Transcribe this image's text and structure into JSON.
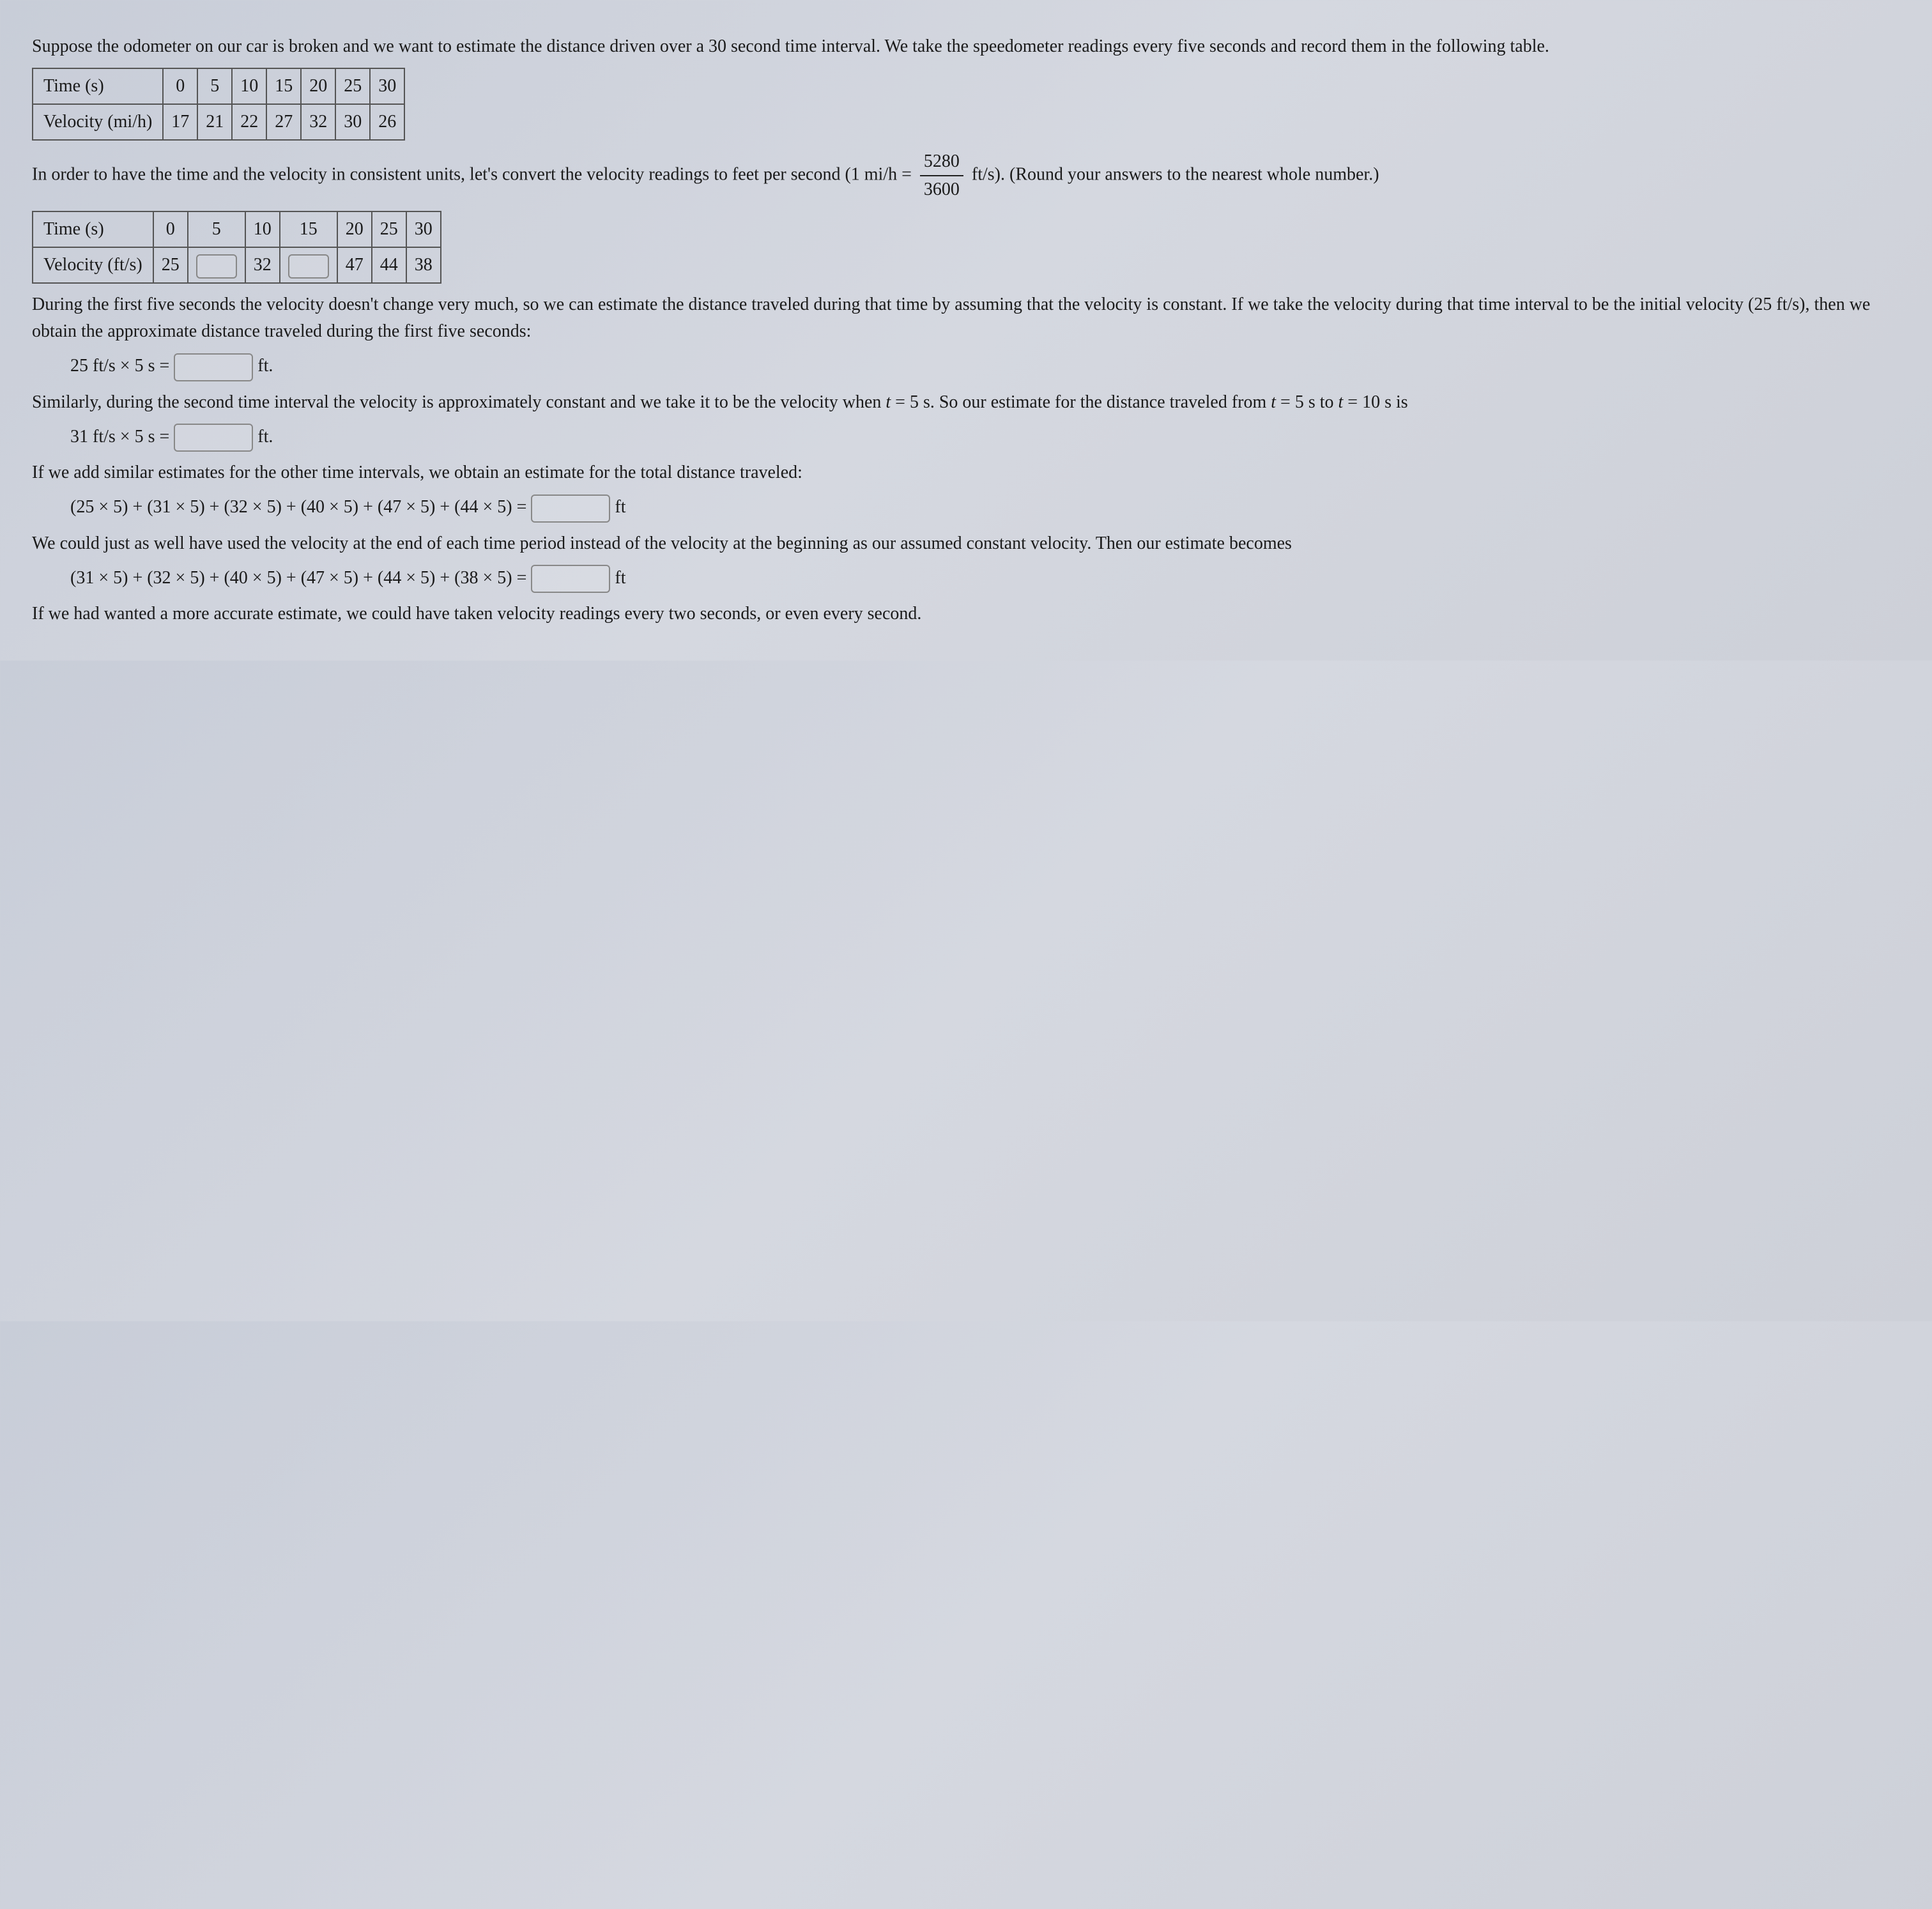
{
  "intro": "Suppose the odometer on our car is broken and we want to estimate the distance driven over a 30 second time interval. We take the speedometer readings every five seconds and record them in the following table.",
  "table1": {
    "row1label": "Time (s)",
    "row1": [
      "0",
      "5",
      "10",
      "15",
      "20",
      "25",
      "30"
    ],
    "row2label": "Velocity (mi/h)",
    "row2": [
      "17",
      "21",
      "22",
      "27",
      "32",
      "30",
      "26"
    ]
  },
  "convert_pre": "In order to have the time and the velocity in consistent units, let's convert the velocity readings to feet per second (1 mi/h =",
  "frac_num": "5280",
  "frac_den": "3600",
  "convert_post": "ft/s). (Round your answers to the nearest whole number.)",
  "table2": {
    "row1label": "Time (s)",
    "row1": [
      "0",
      "5",
      "10",
      "15",
      "20",
      "25",
      "30"
    ],
    "row2label": "Velocity (ft/s)",
    "row2_0": "25",
    "row2_2": "32",
    "row2_4": "47",
    "row2_5": "44",
    "row2_6": "38"
  },
  "para2": "During the first five seconds the velocity doesn't change very much, so we can estimate the distance traveled during that time by assuming that the velocity is constant. If we take the velocity during that time interval to be the initial velocity (25 ft/s), then we obtain the approximate distance traveled during the first five seconds:",
  "eq1_left": "25 ft/s × 5 s =",
  "eq1_unit": "ft.",
  "para3a": "Similarly, during the second time interval the velocity is approximately constant and we take it to be the velocity when ",
  "para3b": " = 5 s. So our estimate for the distance traveled from ",
  "para3c": " = 5 s to ",
  "para3d": " = 10 s is",
  "t_var": "t",
  "eq2_left": "31 ft/s × 5 s =",
  "eq2_unit": "ft.",
  "para4": "If we add similar estimates for the other time intervals, we obtain an estimate for the total distance traveled:",
  "eq3": "(25 × 5) + (31 × 5) + (32 × 5) + (40 × 5) + (47 × 5) + (44 × 5) =",
  "eq3_unit": "ft",
  "para5": "We could just as well have used the velocity at the end of each time period instead of the velocity at the beginning as our assumed constant velocity. Then our estimate becomes",
  "eq4": "(31 × 5) + (32 × 5) + (40 × 5) + (47 × 5) + (44 × 5) + (38 × 5) =",
  "eq4_unit": "ft",
  "para6": "If we had wanted a more accurate estimate, we could have taken velocity readings every two seconds, or even every second."
}
